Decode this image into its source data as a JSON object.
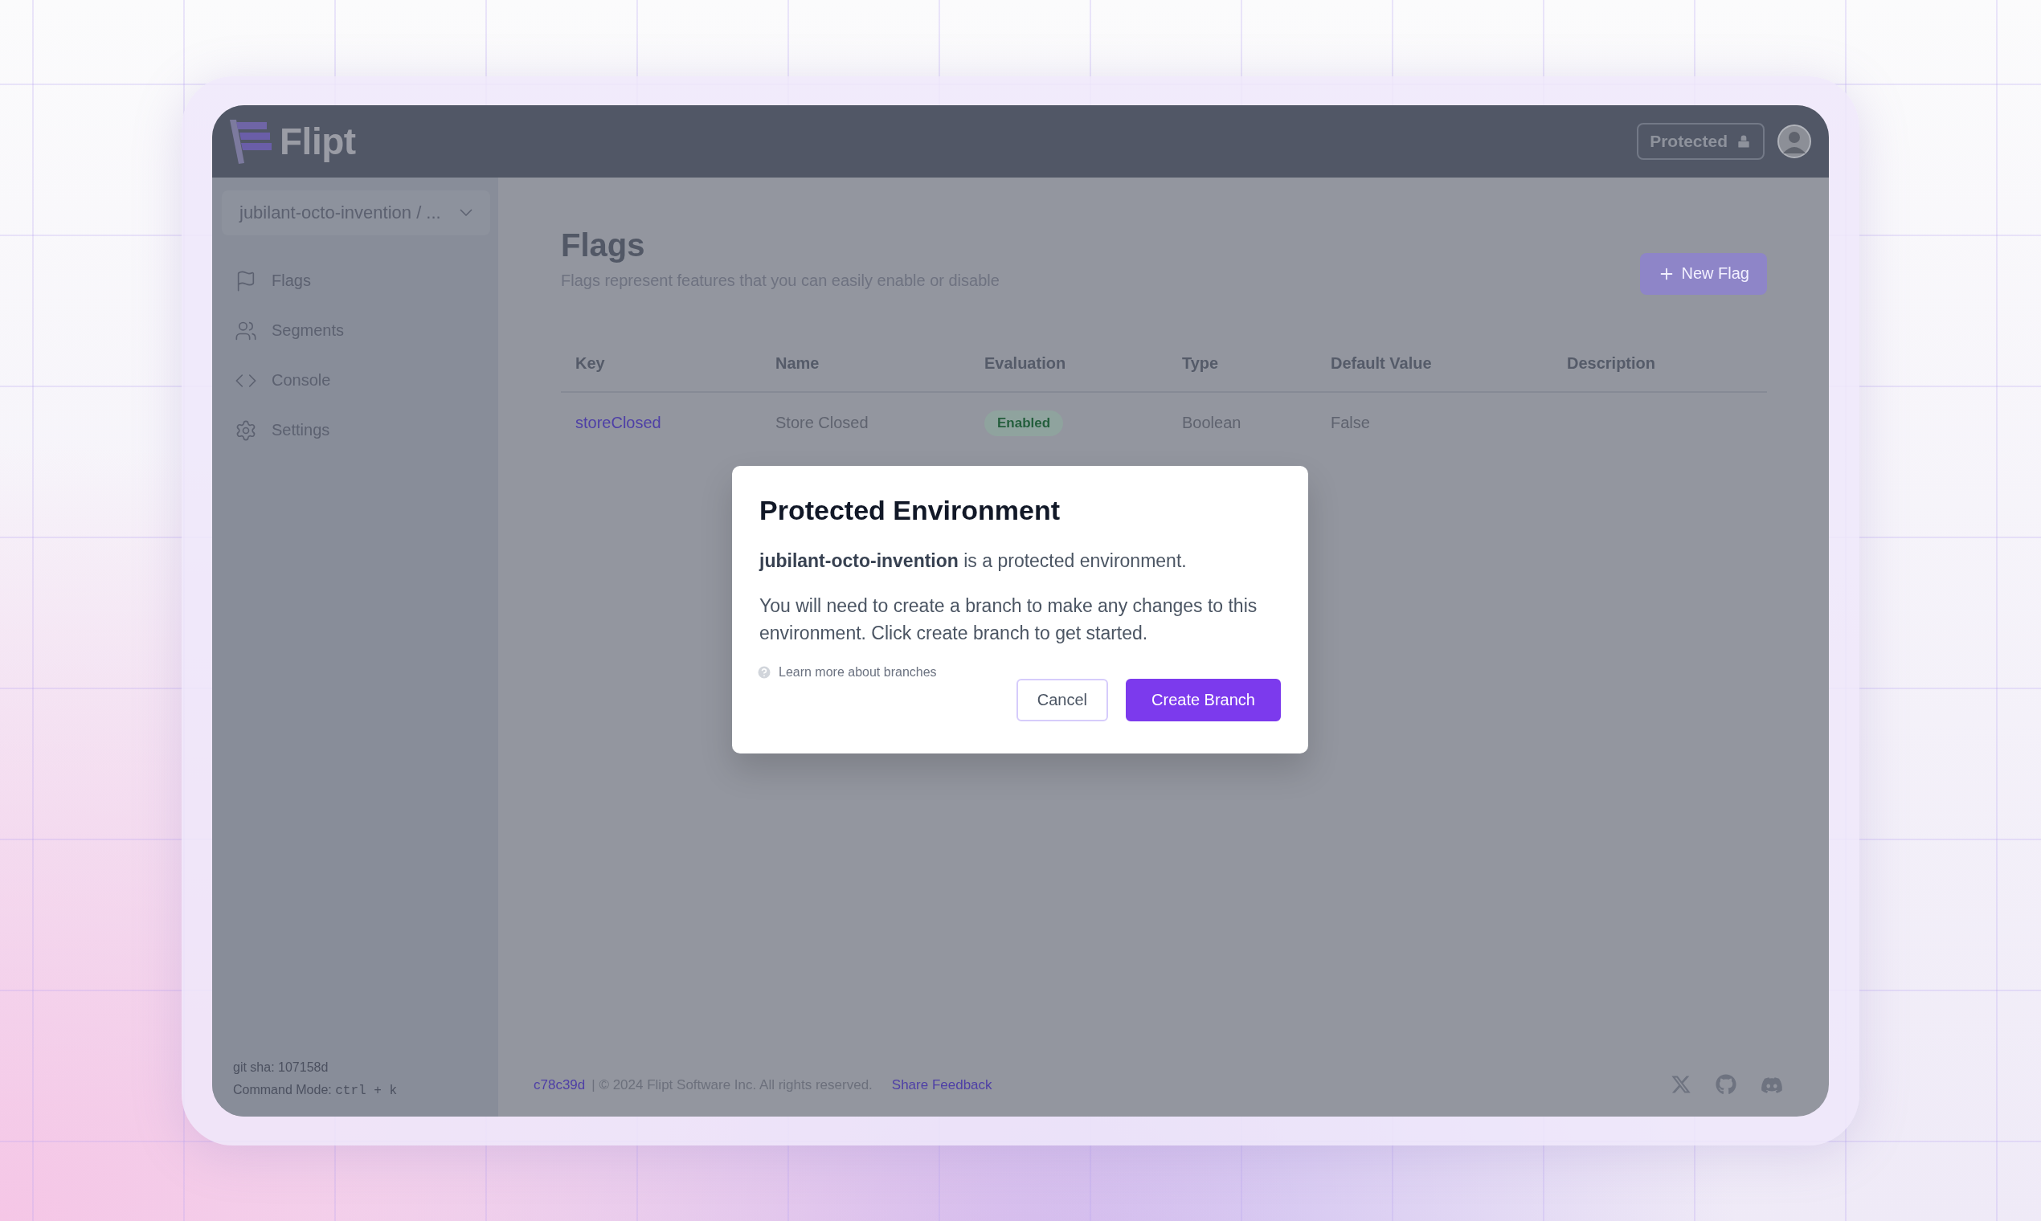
{
  "header": {
    "logo_text": "Flipt",
    "protected_badge": "Protected"
  },
  "sidebar": {
    "environment": "jubilant-octo-invention / ...",
    "items": [
      {
        "label": "Flags",
        "kind": "flag"
      },
      {
        "label": "Segments",
        "kind": "users"
      },
      {
        "label": "Console",
        "kind": "code"
      },
      {
        "label": "Settings",
        "kind": "settings"
      }
    ],
    "git_sha": "git sha: 107158d",
    "command_mode": {
      "label": "Command Mode:",
      "keys": "ctrl + k"
    }
  },
  "page": {
    "title": "Flags",
    "subtitle": "Flags represent features that you can easily enable or disable",
    "new_button": "New Flag"
  },
  "table": {
    "columns": [
      "Key",
      "Name",
      "Evaluation",
      "Type",
      "Default Value",
      "Description"
    ],
    "rows": [
      {
        "key": "storeClosed",
        "name": "Store Closed",
        "evaluation": {
          "label": "Enabled",
          "enabled": true
        },
        "type": "Boolean",
        "default_value": "False"
      }
    ]
  },
  "footer": {
    "commit": "c78c39d",
    "copyright": "| © 2024 Flipt Software Inc. All rights reserved.",
    "feedback": "Share Feedback",
    "social": [
      {
        "kind": "x"
      },
      {
        "kind": "github"
      },
      {
        "kind": "discord"
      }
    ]
  },
  "modal": {
    "title": "Protected Environment",
    "message": "**jubilant-octo-invention** is a protected environment.",
    "detail": "You will need to create a branch to make any changes to this environment. Click create branch to get started.",
    "help_link": "Learn more about branches",
    "buttons": [
      {
        "label": "Cancel",
        "kind": "secondary"
      },
      {
        "label": "Create Branch",
        "kind": "primary"
      }
    ]
  }
}
